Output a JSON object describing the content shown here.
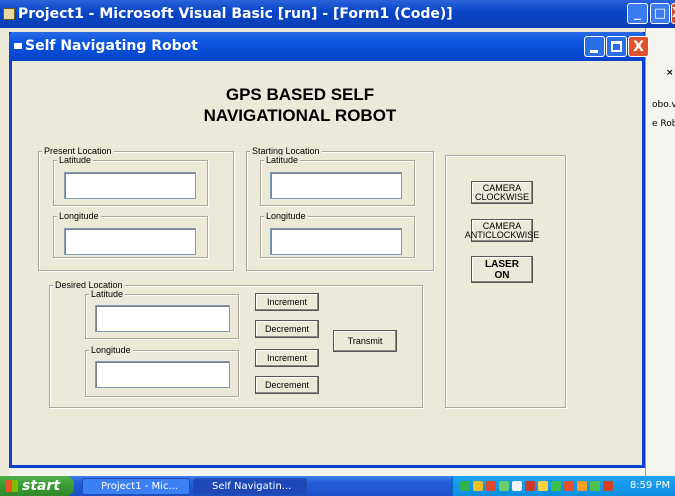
{
  "ide": {
    "title": "Project1 - Microsoft Visual Basic [run] - [Form1 (Code)]",
    "minimize": "_",
    "maximize": "□",
    "close": "X",
    "side_texts": [
      "×",
      "obo.vl",
      "e Robo"
    ]
  },
  "form": {
    "title": "Self Navigating Robot",
    "close": "X",
    "heading_line1": "GPS BASED SELF",
    "heading_line2": "NAVIGATIONAL ROBOT",
    "present": {
      "label": "Present Location",
      "latitude_label": "Latitude",
      "longitude_label": "Longitude",
      "latitude_value": "",
      "longitude_value": ""
    },
    "starting": {
      "label": "Starting Location",
      "latitude_label": "Latitude",
      "longitude_label": "Longitude",
      "latitude_value": "",
      "longitude_value": ""
    },
    "desired": {
      "label": "Desired Location",
      "latitude_label": "Latitude",
      "longitude_label": "Longitude",
      "latitude_value": "",
      "longitude_value": "",
      "increment_label": "Increment",
      "decrement_label": "Decrement",
      "transmit_label": "Transmit"
    },
    "camera": {
      "clockwise_line1": "CAMERA",
      "clockwise_line2": "CLOCKWISE",
      "anticlockwise_line1": "CAMERA",
      "anticlockwise_line2": "ANTICLOCKWISE",
      "laser_label": "LASER ON"
    }
  },
  "taskbar": {
    "start_label": "start",
    "tasks": [
      "Project1 - Mic...",
      "Self Navigatin..."
    ],
    "clock": "8:59 PM"
  },
  "colors": {
    "titlebar": "#0b55e0",
    "taskbar": "#245edb",
    "start": "#3a9a32",
    "close_button": "#e0512e",
    "form_bg": "#ece9d8"
  }
}
